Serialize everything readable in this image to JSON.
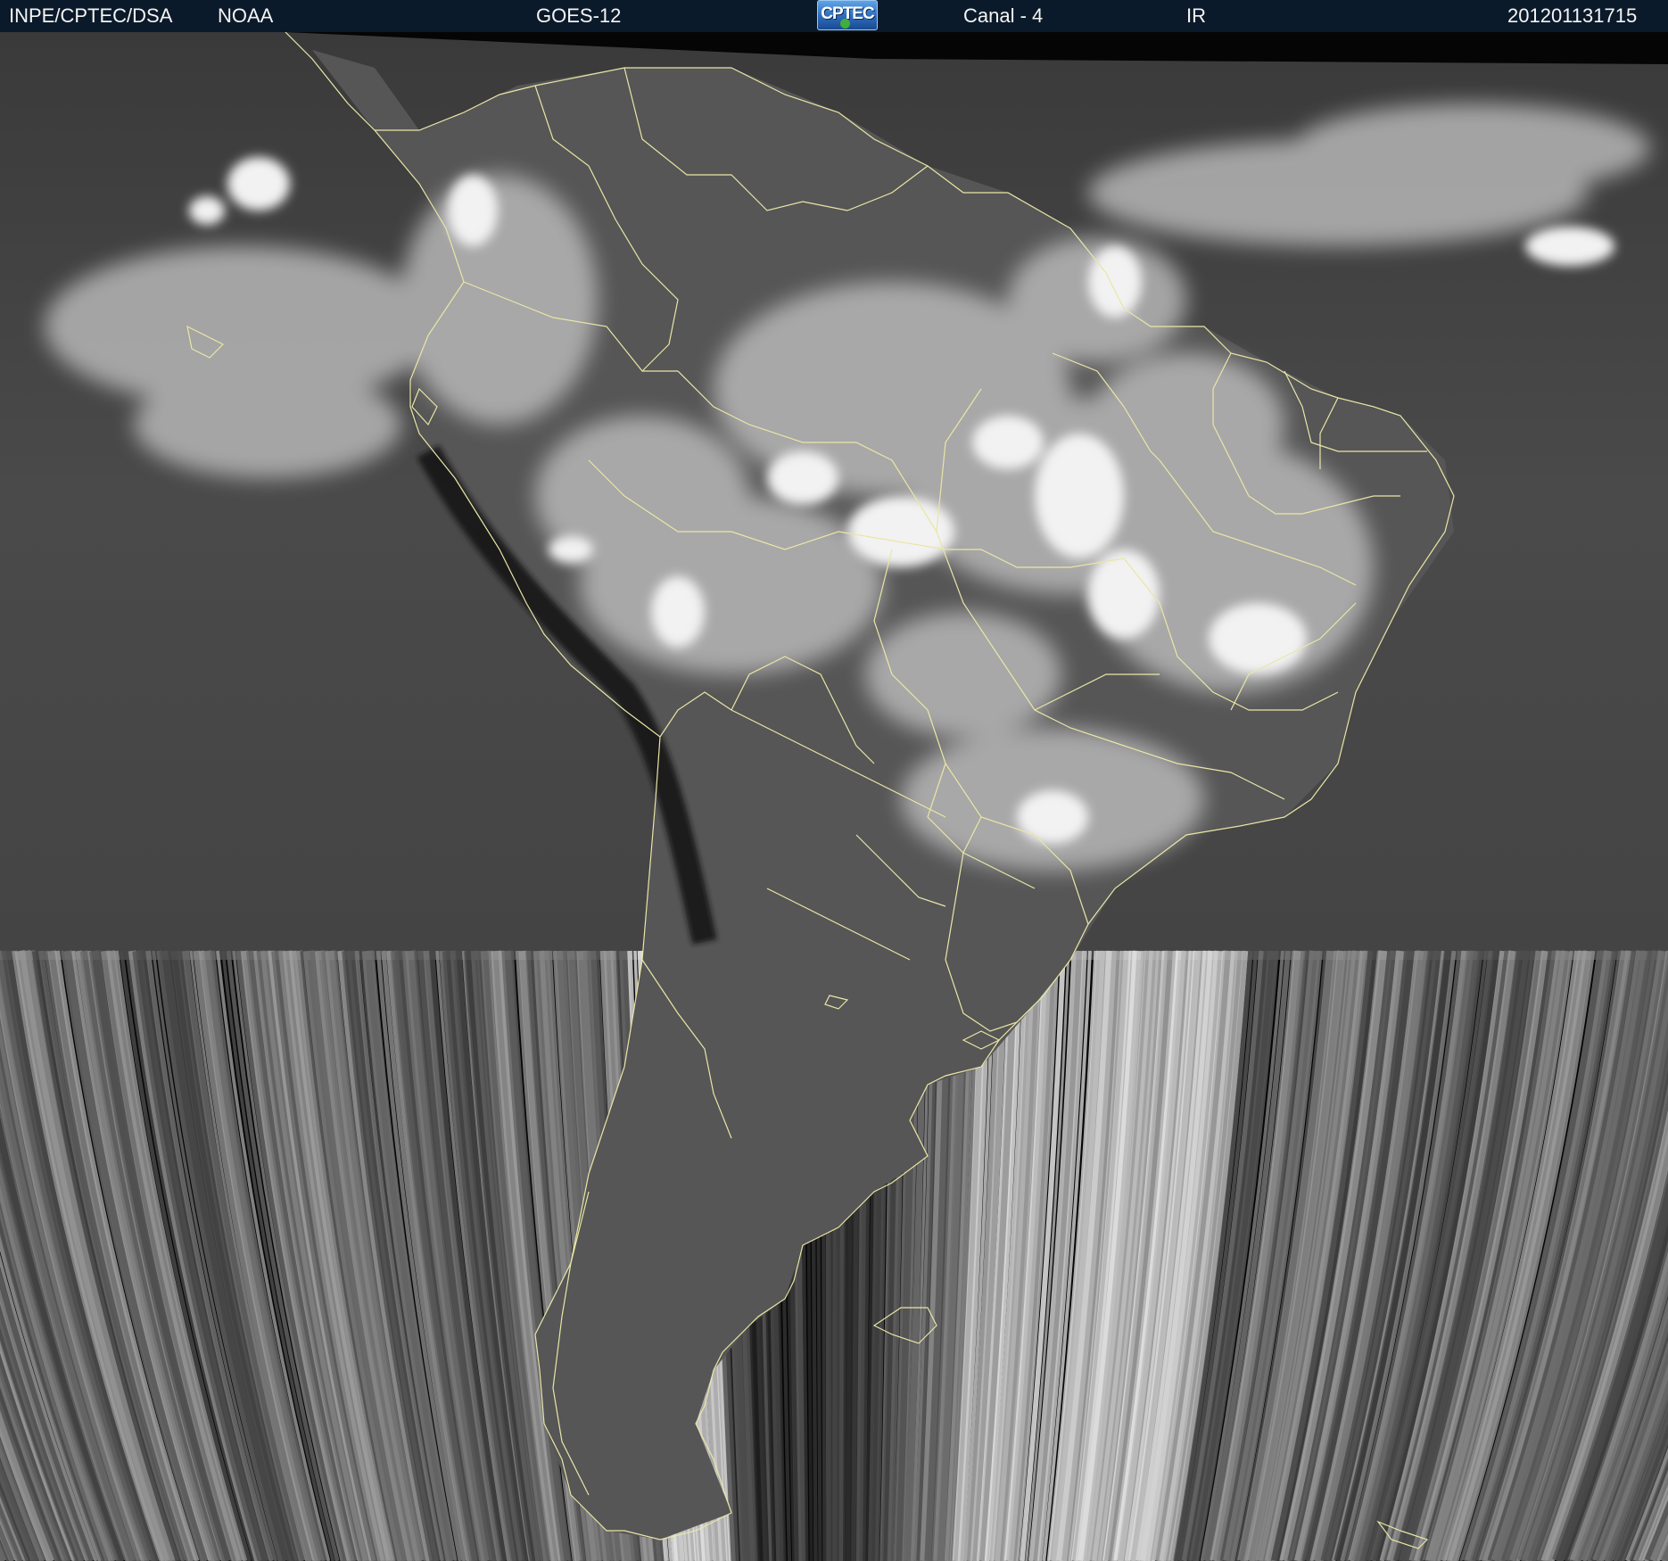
{
  "header": {
    "agency": "INPE/CPTEC/DSA",
    "source": "NOAA",
    "satellite": "GOES-12",
    "logo_text": "CPTEC",
    "channel": "Canal - 4",
    "band": "IR",
    "timestamp": "201201131715"
  },
  "colors": {
    "header_background": "#0b1a2a",
    "header_text": "#f4f4f4",
    "coastline": "#e9e6a6",
    "ocean_gray": "#4a4a4a",
    "cloud_white": "#f2f2f2"
  }
}
